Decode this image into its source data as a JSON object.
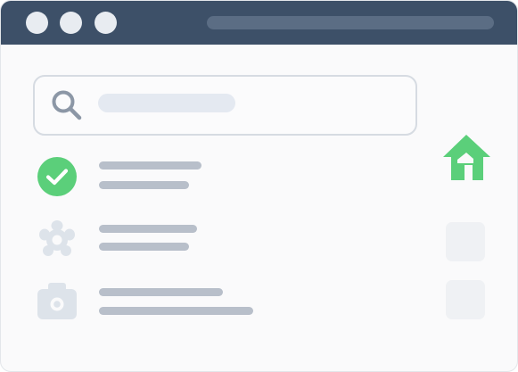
{
  "window": {
    "titlebar_buttons": [
      "close-button",
      "minimize-button",
      "maximize-button"
    ]
  },
  "search": {
    "icon": "search-icon"
  },
  "list": {
    "items": [
      {
        "icon": "check-circle-icon",
        "status": "completed"
      },
      {
        "icon": "gear-icon",
        "status": "inactive"
      },
      {
        "icon": "camera-icon",
        "status": "inactive"
      }
    ]
  },
  "side": {
    "icon": "home-icon"
  },
  "colors": {
    "titlebar": "#3d5068",
    "accent_green": "#5bcf7a",
    "placeholder": "#b8bfca",
    "icon_muted": "#dde3ea"
  }
}
